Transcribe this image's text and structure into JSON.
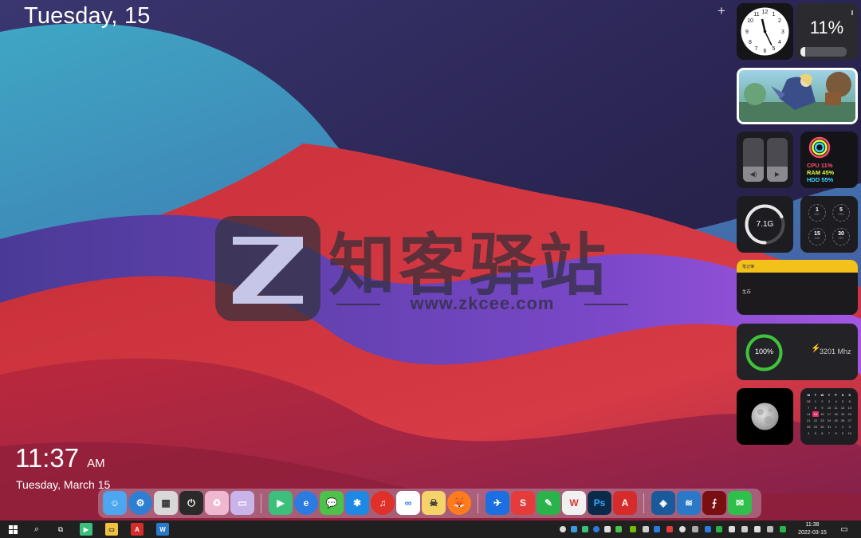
{
  "desktop": {
    "date_header": "Tuesday, 15",
    "add_widget": "+",
    "clock_time": "11:37",
    "clock_ampm": "AM",
    "clock_date": "Tuesday, March 15"
  },
  "watermark": {
    "brand": "知客驿站",
    "url": "www.zkcee.com"
  },
  "widgets": {
    "battery": {
      "percent_text": "11%",
      "level": 0.11
    },
    "volume": {
      "level": 0.35
    },
    "brightness": {
      "level": 0.35
    },
    "system": {
      "cpu": "CPU 11%",
      "ram": "RAM 45%",
      "hdd": "HDD 55%",
      "cpu_color": "#ff4d6d",
      "ram_color": "#d8ff3c",
      "hdd_color": "#38d6ff"
    },
    "memory": {
      "value": "7.1G",
      "level": 0.68
    },
    "countdown": [
      {
        "value": "1",
        "unit": "DAY"
      },
      {
        "value": "5",
        "unit": "HRS"
      },
      {
        "value": "15",
        "unit": "MIN"
      },
      {
        "value": "30",
        "unit": "SEC"
      }
    ],
    "note": {
      "title": "笔记簿",
      "content": "生存"
    },
    "cpu": {
      "percent_text": "100%",
      "level": 1.0,
      "freq": "3201 Mhz"
    },
    "calendar": {
      "headers": [
        "M",
        "T",
        "W",
        "T",
        "F",
        "S",
        "S"
      ],
      "days": [
        "28",
        "1",
        "2",
        "3",
        "4",
        "5",
        "6",
        "7",
        "8",
        "9",
        "10",
        "11",
        "12",
        "13",
        "14",
        "15",
        "16",
        "17",
        "18",
        "19",
        "20",
        "21",
        "22",
        "23",
        "24",
        "25",
        "26",
        "27",
        "28",
        "29",
        "30",
        "31",
        "1",
        "2",
        "3",
        "4",
        "5",
        "6",
        "7",
        "8",
        "9",
        "10"
      ],
      "today": "15"
    }
  },
  "dock": {
    "apps": [
      "Finder",
      "Settings",
      "Launchpad",
      "Shutdown",
      "Recycle Bin",
      "Files",
      "Video",
      "Browser",
      "WeChat",
      "Bookmark",
      "NetEase Music",
      "Baidu Netdisk",
      "Pirate",
      "Firefox",
      "Airplane",
      "SketchUp Tool",
      "Mail",
      "Office",
      "Photoshop",
      "AutoCAD",
      "SketchUp",
      "Layers",
      "Acrobat",
      "Message"
    ]
  },
  "taskbar": {
    "time": "11:38",
    "date": "2022-03-15"
  }
}
